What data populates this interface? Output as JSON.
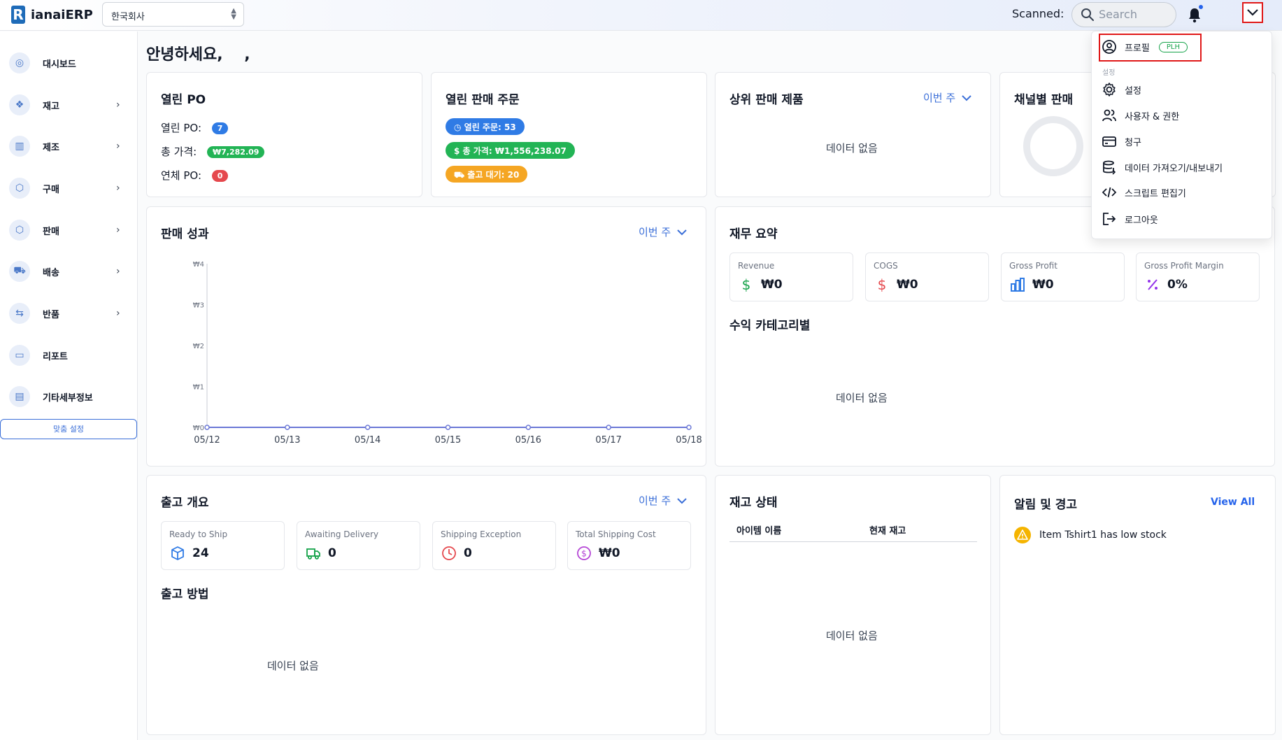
{
  "app": {
    "logo_text": "ianaiERP",
    "logo_mark": "R"
  },
  "header": {
    "company": "한국회사",
    "scanned_label": "Scanned:",
    "search_placeholder": "Search"
  },
  "sidebar": {
    "items": [
      {
        "label": "대시보드",
        "icon": "dashboard-icon",
        "has_arrow": false
      },
      {
        "label": "재고",
        "icon": "inventory-icon",
        "has_arrow": true
      },
      {
        "label": "제조",
        "icon": "factory-icon",
        "has_arrow": true
      },
      {
        "label": "구매",
        "icon": "purchase-icon",
        "has_arrow": true
      },
      {
        "label": "판매",
        "icon": "sales-icon",
        "has_arrow": true
      },
      {
        "label": "배송",
        "icon": "truck-icon",
        "has_arrow": true
      },
      {
        "label": "반품",
        "icon": "return-icon",
        "has_arrow": true
      },
      {
        "label": "리포트",
        "icon": "report-icon",
        "has_arrow": false
      },
      {
        "label": "기타세부정보",
        "icon": "document-icon",
        "has_arrow": false
      }
    ],
    "arrow": "›",
    "customize_label": "맞춤 설정"
  },
  "greeting": "안녕하세요,    ,",
  "open_po": {
    "title": "열린 PO",
    "rows": [
      {
        "label": "열린 PO:",
        "value": "7",
        "color": "#2f7be5"
      },
      {
        "label": "총 가격:",
        "value": "₩7,282.09",
        "color": "#22b455"
      },
      {
        "label": "연체 PO:",
        "value": "0",
        "color": "#e5484d"
      }
    ]
  },
  "open_sales": {
    "title": "열린 판매 주문",
    "tags": [
      {
        "label": "열린 주문: 53",
        "color": "#2f7be5"
      },
      {
        "label": "총 가격: ₩1,556,238.07",
        "color": "#22b455"
      },
      {
        "label": "출고 대기: 20",
        "color": "#f5a623"
      }
    ]
  },
  "top_products": {
    "title": "상위 판매 제품",
    "period": "이번 주",
    "empty": "데이터 없음"
  },
  "channel_sales": {
    "title": "채널별 판매"
  },
  "sales_performance": {
    "title": "판매 성과",
    "period": "이번 주"
  },
  "chart_data": {
    "type": "line",
    "x": [
      "05/12",
      "05/13",
      "05/14",
      "05/15",
      "05/16",
      "05/17",
      "05/18"
    ],
    "series": [
      {
        "values": [
          0,
          0,
          0,
          0,
          0,
          0,
          0
        ]
      }
    ],
    "y_ticks": [
      "₩0",
      "₩1",
      "₩2",
      "₩3",
      "₩4"
    ],
    "ylim": [
      0,
      4
    ],
    "color": "#6b78d6"
  },
  "finance": {
    "title": "재무 요약",
    "stats": [
      {
        "label": "Revenue",
        "value": "₩0",
        "icon": "dollar-icon",
        "color": "#16a34a"
      },
      {
        "label": "COGS",
        "value": "₩0",
        "icon": "dollar-icon",
        "color": "#e5484d"
      },
      {
        "label": "Gross Profit",
        "value": "₩0",
        "icon": "bar-chart-icon",
        "color": "#2f7be5"
      },
      {
        "label": "Gross Profit Margin",
        "value": "0%",
        "icon": "percent-icon",
        "color": "#9333ea"
      }
    ],
    "category_title": "수익 카테고리별",
    "empty": "데이터 없음"
  },
  "shipping": {
    "title": "출고 개요",
    "period": "이번 주",
    "stats": [
      {
        "label": "Ready to Ship",
        "value": "24",
        "icon": "box-icon",
        "color": "#2f7be5"
      },
      {
        "label": "Awaiting Delivery",
        "value": "0",
        "icon": "truck-icon",
        "color": "#16a34a"
      },
      {
        "label": "Shipping Exception",
        "value": "0",
        "icon": "clock-icon",
        "color": "#e5484d"
      },
      {
        "label": "Total Shipping Cost",
        "value": "₩0",
        "icon": "coin-icon",
        "color": "#b547d6"
      }
    ],
    "method_title": "출고 방법",
    "empty": "데이터 없음"
  },
  "stock": {
    "title": "재고 상태",
    "columns": [
      "아이템 이름",
      "현재 재고"
    ],
    "empty": "데이터 없음"
  },
  "alerts": {
    "title": "알림 및 경고",
    "view_all": "View All",
    "items": [
      {
        "text": "Item Tshirt1 has low stock"
      }
    ]
  },
  "profile_menu": {
    "profile_label": "프로필",
    "profile_badge": "PLH",
    "section_label": "설정",
    "items": [
      {
        "label": "설정",
        "icon": "gear-icon"
      },
      {
        "label": "사용자 & 권한",
        "icon": "users-icon"
      },
      {
        "label": "청구",
        "icon": "credit-card-icon"
      },
      {
        "label": "데이터 가져오기/내보내기",
        "icon": "database-icon"
      },
      {
        "label": "스크립트 편집기",
        "icon": "code-icon"
      },
      {
        "label": "로그아웃",
        "icon": "logout-icon"
      }
    ]
  }
}
